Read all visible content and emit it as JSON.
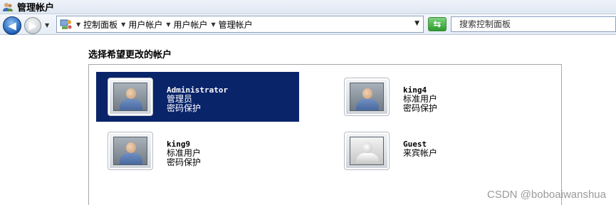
{
  "window": {
    "title": "管理帐户"
  },
  "nav": {
    "back_icon": "back-arrow-icon",
    "forward_icon": "forward-arrow-icon",
    "breadcrumbs": [
      "控制面板",
      "用户帐户",
      "用户帐户",
      "管理帐户"
    ],
    "refresh_icon": "refresh-arrows-icon"
  },
  "search": {
    "placeholder": "搜索控制面板"
  },
  "main": {
    "heading": "选择希望更改的帐户",
    "accounts": [
      {
        "name": "Administrator",
        "type": "管理员",
        "status": "密码保护",
        "selected": true,
        "icon": "user-picture-icon"
      },
      {
        "name": "king4",
        "type": "标准用户",
        "status": "密码保护",
        "selected": false,
        "icon": "user-picture-icon"
      },
      {
        "name": "king9",
        "type": "标准用户",
        "status": "密码保护",
        "selected": false,
        "icon": "user-picture-icon"
      },
      {
        "name": "Guest",
        "type": "来宾帐户",
        "status": "",
        "selected": false,
        "icon": "guest-picture-icon"
      }
    ]
  },
  "watermark": "CSDN @boboaiwanshua",
  "colors": {
    "selection": "#0a246a",
    "selection_text": "#ffffff"
  }
}
